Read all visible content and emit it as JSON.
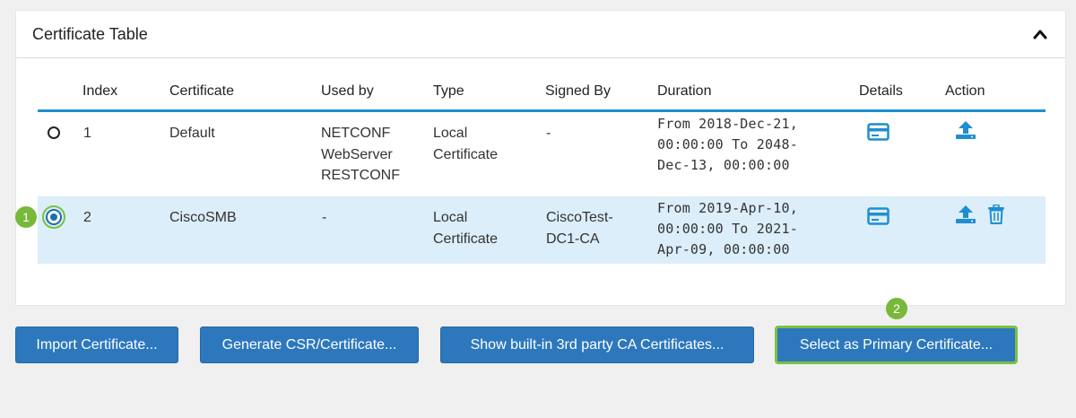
{
  "panel": {
    "title": "Certificate Table"
  },
  "table": {
    "columns": [
      "Index",
      "Certificate",
      "Used by",
      "Type",
      "Signed By",
      "Duration",
      "Details",
      "Action"
    ],
    "rows": [
      {
        "index": "1",
        "certificate": "Default",
        "used_by": [
          "NETCONF",
          "WebServer",
          "RESTCONF"
        ],
        "type": [
          "Local",
          "Certificate"
        ],
        "signed_by": "-",
        "duration": [
          "From 2018-Dec-21,",
          "00:00:00 To 2048-",
          "Dec-13, 00:00:00"
        ],
        "selected": false
      },
      {
        "index": "2",
        "certificate": "CiscoSMB",
        "used_by": [
          "-"
        ],
        "type": [
          "Local",
          "Certificate"
        ],
        "signed_by": [
          "CiscoTest-",
          "DC1-CA"
        ],
        "duration": [
          "From 2019-Apr-10,",
          "00:00:00 To 2021-",
          "Apr-09, 00:00:00"
        ],
        "selected": true
      }
    ]
  },
  "annotations": {
    "step1": "1",
    "step2": "2"
  },
  "buttons": {
    "import": "Import Certificate...",
    "generate": "Generate CSR/Certificate...",
    "show_ca": "Show built-in 3rd party CA Certificates...",
    "primary": "Select as Primary Certificate..."
  },
  "colors": {
    "accent": "#1f8ed0",
    "button": "#2d78bd",
    "highlight": "#78b83a",
    "selected_row": "#dbeef9"
  },
  "icons": {
    "collapse": "chevron-up-icon",
    "details": "card-icon",
    "export": "upload-icon",
    "delete": "trash-icon"
  }
}
